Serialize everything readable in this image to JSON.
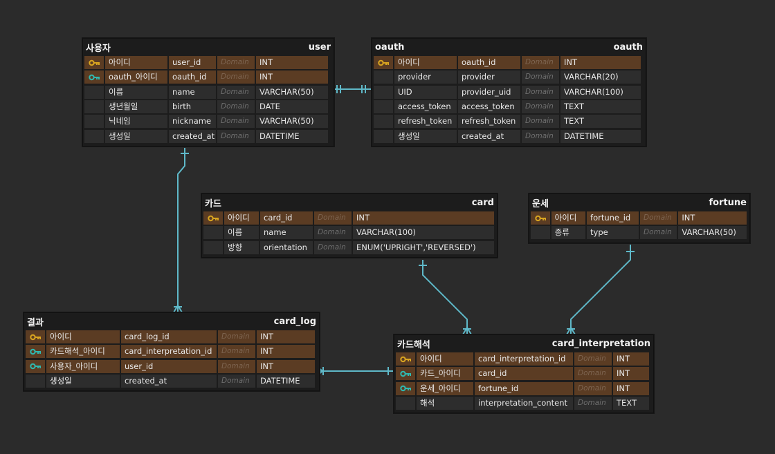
{
  "entities": {
    "user": {
      "logical": "사용자",
      "physical": "user",
      "rows": [
        {
          "key": "pk",
          "logical": "아이디",
          "physical": "user_id",
          "domain": "Domain",
          "type": "INT"
        },
        {
          "key": "fk",
          "logical": "oauth_아이디",
          "physical": "oauth_id",
          "domain": "Domain",
          "type": "INT"
        },
        {
          "key": "",
          "logical": "이름",
          "physical": "name",
          "domain": "Domain",
          "type": "VARCHAR(50)"
        },
        {
          "key": "",
          "logical": "생년월일",
          "physical": "birth",
          "domain": "Domain",
          "type": "DATE"
        },
        {
          "key": "",
          "logical": "닉네임",
          "physical": "nickname",
          "domain": "Domain",
          "type": "VARCHAR(50)"
        },
        {
          "key": "",
          "logical": "생성일",
          "physical": "created_at",
          "domain": "Domain",
          "type": "DATETIME"
        }
      ]
    },
    "oauth": {
      "logical": "oauth",
      "physical": "oauth",
      "rows": [
        {
          "key": "pk",
          "logical": "아이디",
          "physical": "oauth_id",
          "domain": "Domain",
          "type": "INT"
        },
        {
          "key": "",
          "logical": "provider",
          "physical": "provider",
          "domain": "Domain",
          "type": "VARCHAR(20)"
        },
        {
          "key": "",
          "logical": "UID",
          "physical": "provider_uid",
          "domain": "Domain",
          "type": "VARCHAR(100)"
        },
        {
          "key": "",
          "logical": "access_token",
          "physical": "access_token",
          "domain": "Domain",
          "type": "TEXT"
        },
        {
          "key": "",
          "logical": "refresh_token",
          "physical": "refresh_token",
          "domain": "Domain",
          "type": "TEXT"
        },
        {
          "key": "",
          "logical": "생성일",
          "physical": "created_at",
          "domain": "Domain",
          "type": "DATETIME"
        }
      ]
    },
    "card": {
      "logical": "카드",
      "physical": "card",
      "rows": [
        {
          "key": "pk",
          "logical": "아이디",
          "physical": "card_id",
          "domain": "Domain",
          "type": "INT"
        },
        {
          "key": "",
          "logical": "이름",
          "physical": "name",
          "domain": "Domain",
          "type": "VARCHAR(100)"
        },
        {
          "key": "",
          "logical": "방향",
          "physical": "orientation",
          "domain": "Domain",
          "type": "ENUM('UPRIGHT','REVERSED')"
        }
      ]
    },
    "fortune": {
      "logical": "운세",
      "physical": "fortune",
      "rows": [
        {
          "key": "pk",
          "logical": "아이디",
          "physical": "fortune_id",
          "domain": "Domain",
          "type": "INT"
        },
        {
          "key": "",
          "logical": "종류",
          "physical": "type",
          "domain": "Domain",
          "type": "VARCHAR(50)"
        }
      ]
    },
    "card_log": {
      "logical": "결과",
      "physical": "card_log",
      "rows": [
        {
          "key": "pk",
          "logical": "아이디",
          "physical": "card_log_id",
          "domain": "Domain",
          "type": "INT"
        },
        {
          "key": "fk",
          "logical": "카드해석_아이디",
          "physical": "card_interpretation_id",
          "domain": "Domain",
          "type": "INT"
        },
        {
          "key": "fk",
          "logical": "사용자_아이디",
          "physical": "user_id",
          "domain": "Domain",
          "type": "INT"
        },
        {
          "key": "",
          "logical": "생성일",
          "physical": "created_at",
          "domain": "Domain",
          "type": "DATETIME"
        }
      ]
    },
    "card_interpretation": {
      "logical": "카드해석",
      "physical": "card_interpretation",
      "rows": [
        {
          "key": "pk",
          "logical": "아이디",
          "physical": "card_interpretation_id",
          "domain": "Domain",
          "type": "INT"
        },
        {
          "key": "fk",
          "logical": "카드_아이디",
          "physical": "card_id",
          "domain": "Domain",
          "type": "INT"
        },
        {
          "key": "fk",
          "logical": "운세_아이디",
          "physical": "fortune_id",
          "domain": "Domain",
          "type": "INT"
        },
        {
          "key": "",
          "logical": "해석",
          "physical": "interpretation_content",
          "domain": "Domain",
          "type": "TEXT"
        }
      ]
    }
  },
  "colors": {
    "pk_key": "#d9a520",
    "fk_key": "#2fb9b1",
    "relation_line": "#5fb9c9",
    "key_row": "#5b3c23"
  }
}
